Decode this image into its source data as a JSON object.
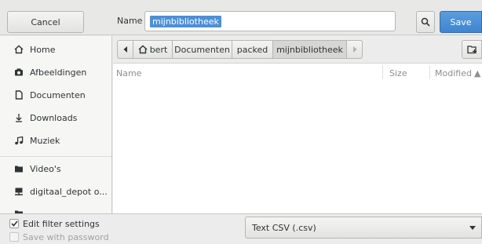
{
  "header": {
    "cancel_label": "Cancel",
    "name_label": "Name",
    "name_value": "mijnbibliotheek",
    "save_label": "Save"
  },
  "sidebar": {
    "items": [
      {
        "label": "Home",
        "icon": "home-icon"
      },
      {
        "label": "Afbeeldingen",
        "icon": "camera-icon"
      },
      {
        "label": "Documenten",
        "icon": "document-icon"
      },
      {
        "label": "Downloads",
        "icon": "download-icon"
      },
      {
        "label": "Muziek",
        "icon": "music-icon"
      },
      {
        "label": "Video's",
        "icon": "folder-icon"
      },
      {
        "label": "digitaal_depot o...",
        "icon": "network-drive-icon"
      },
      {
        "label": "",
        "icon": "folder-icon"
      }
    ]
  },
  "pathbar": {
    "segments": [
      "bert",
      "Documenten",
      "packed",
      "mijnbibliotheek"
    ],
    "active": "mijnbibliotheek"
  },
  "filelist": {
    "columns": [
      "Name",
      "Size",
      "Modified"
    ],
    "sort_indicator": "▲"
  },
  "bottom": {
    "edit_filter_label": "Edit filter settings",
    "edit_filter_checked": true,
    "save_password_label": "Save with password",
    "save_password_checked": false,
    "filetype_value": "Text CSV (.csv)"
  },
  "colors": {
    "accent": "#4a90d9",
    "save_button": "#4a90d9"
  }
}
